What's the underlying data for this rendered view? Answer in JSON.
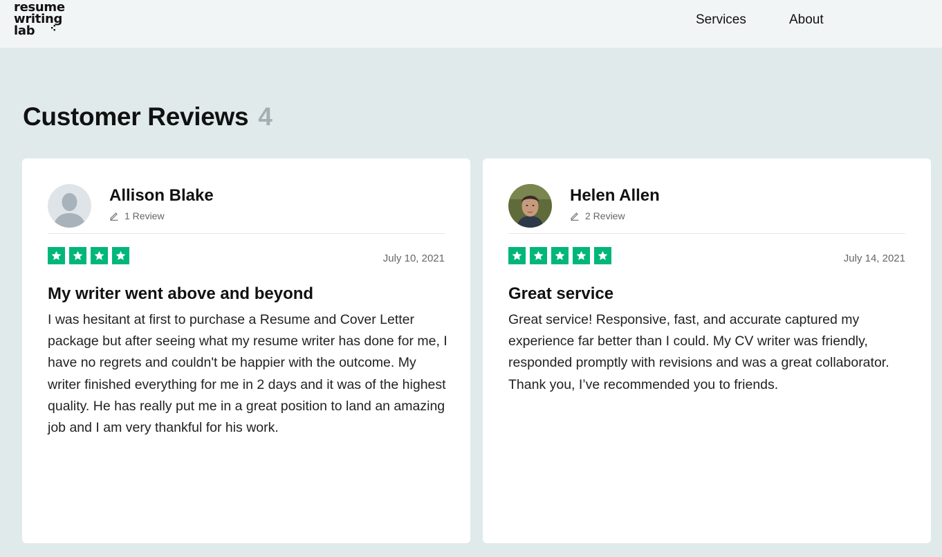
{
  "header": {
    "logo_lines": [
      "resume",
      "writing",
      "lab"
    ],
    "nav": [
      {
        "label": "Services"
      },
      {
        "label": "About"
      }
    ]
  },
  "page": {
    "title": "Customer Reviews",
    "count": "4"
  },
  "reviews": [
    {
      "name": "Allison Blake",
      "review_count": "1 Review",
      "avatar": "default-user-avatar",
      "rating": 4,
      "date": "July 10, 2021",
      "title": "My writer went above and beyond",
      "body": "I was hesitant at first to purchase a Resume and Cover Letter package but after seeing what my resume writer has done for me, I have no regrets and couldn't be happier with the outcome. My writer finished everything for me in 2 days and it was of the highest quality. He has really put me in a great position to land an amazing job and I am very thankful for his work."
    },
    {
      "name": "Helen Allen",
      "review_count": "2 Review",
      "avatar": "user-photo",
      "rating": 5,
      "date": "July 14, 2021",
      "title": "Great service",
      "body": "Great service! Responsive, fast, and accurate captured my experience far better than I could. My CV writer was friendly, responded promptly with revisions and was a great collaborator. Thank you, I’ve recommended you to friends."
    }
  ],
  "colors": {
    "page_bg": "#e0eaea",
    "header_bg": "#f2f5f5",
    "star_green": "#00b67a",
    "count_gray": "#a5afb3"
  }
}
